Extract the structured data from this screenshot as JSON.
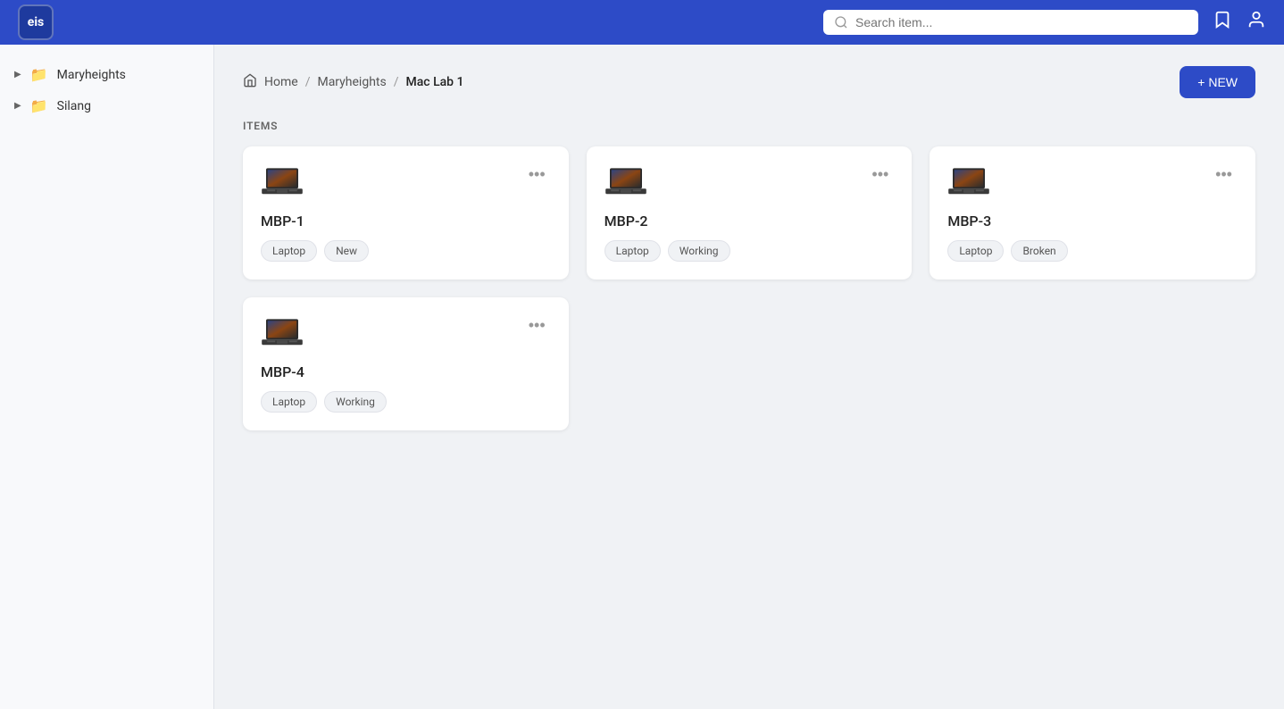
{
  "header": {
    "logo_text": "eis",
    "search_placeholder": "Search item...",
    "bookmark_icon": "🔖",
    "user_icon": "👤"
  },
  "sidebar": {
    "items": [
      {
        "label": "Maryheights",
        "icon": "folder"
      },
      {
        "label": "Silang",
        "icon": "folder"
      }
    ]
  },
  "breadcrumb": {
    "home_label": "Home",
    "separator": "/",
    "path1": "Maryheights",
    "path2": "Mac Lab 1"
  },
  "new_button_label": "+ NEW",
  "items_section_label": "ITEMS",
  "cards": [
    {
      "id": "MBP-1",
      "title": "MBP-1",
      "tags": [
        "Laptop",
        "New"
      ]
    },
    {
      "id": "MBP-2",
      "title": "MBP-2",
      "tags": [
        "Laptop",
        "Working"
      ]
    },
    {
      "id": "MBP-3",
      "title": "MBP-3",
      "tags": [
        "Laptop",
        "Broken"
      ]
    },
    {
      "id": "MBP-4",
      "title": "MBP-4",
      "tags": [
        "Laptop",
        "Working"
      ]
    }
  ]
}
